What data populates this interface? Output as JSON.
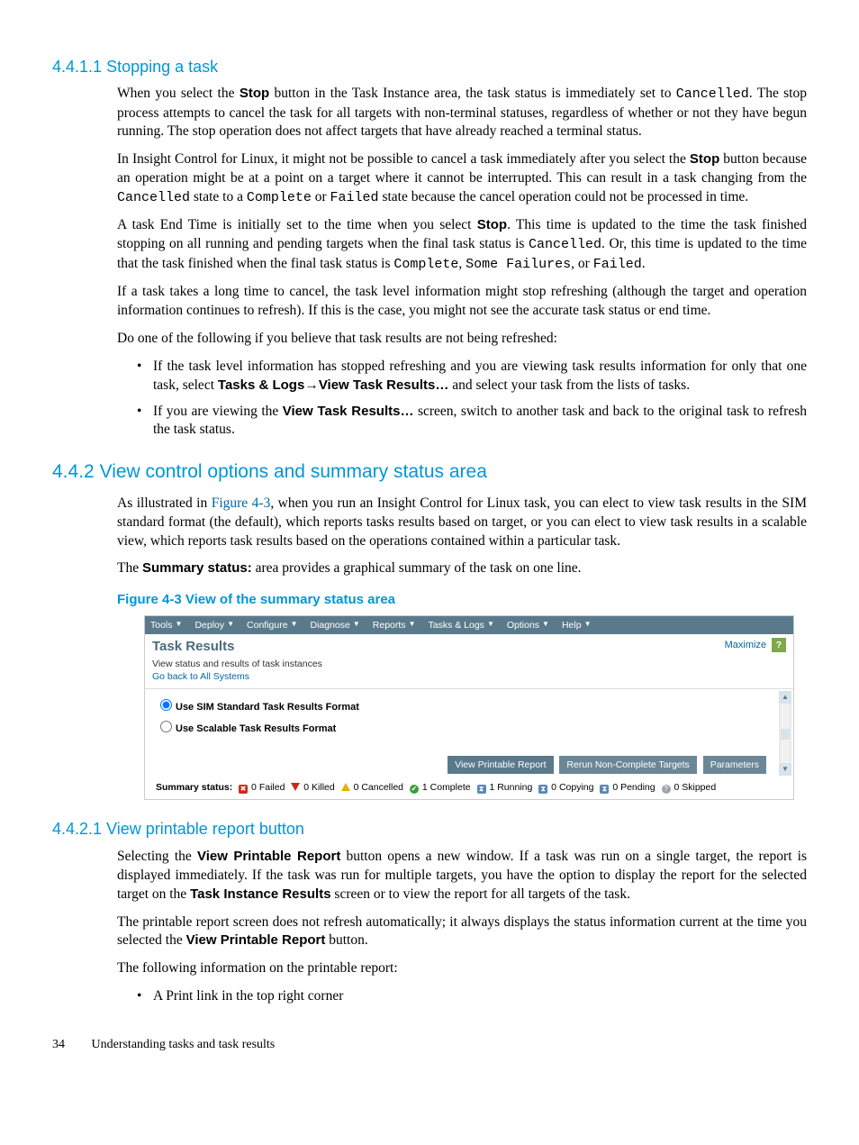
{
  "sections": {
    "s1_num": "4.4.1.1",
    "s1_title": "Stopping a task",
    "s2_num": "4.4.2",
    "s2_title": "View control options and summary status area",
    "s3_num": "4.4.2.1",
    "s3_title": "View printable report button"
  },
  "p": {
    "a1a": "When you select the ",
    "a1_stop": "Stop",
    "a1b": " button in the Task Instance area, the task status is immediately set to ",
    "a1_code": "Cancelled",
    "a1c": ". The stop process attempts to cancel the task for all targets with non-terminal statuses, regardless of whether or not they have begun running. The stop operation does not affect targets that have already reached a terminal status.",
    "a2a": "In Insight Control for Linux, it might not be possible to cancel a task immediately after you select the ",
    "a2b": " button because an operation might be at a point on a target where it cannot be interrupted. This can result in a task changing from the ",
    "a2_code1": "Cancelled",
    "a2c": " state to a ",
    "a2_code2": "Complete",
    "a2d": " or ",
    "a2_code3": "Failed",
    "a2e": " state because the cancel operation could not be processed in time.",
    "a3a": "A task End Time is initially set to the time when you select ",
    "a3b": ". This time is updated to the time the task finished stopping on all running and pending targets when the final task status is ",
    "a3_code1": "Cancelled",
    "a3c": ". Or, this time is updated to the time that the task finished when the final task status is ",
    "a3_code2": "Complete",
    "a3d": ", ",
    "a3_code3": "Some Failures",
    "a3e": ", or ",
    "a3_code4": "Failed",
    "a3f": ".",
    "a4": "If a task takes a long time to cancel, the task level information might stop refreshing (although the target and operation information continues to refresh). If this is the case, you might not see the accurate task status or end time.",
    "a5": "Do one of the following if you believe that task results are not being refreshed:",
    "b1a": "If the task level information has stopped refreshing and you are viewing task results information for only that one task, select ",
    "b1_bold1": "Tasks & Logs",
    "b1_arrow": "→",
    "b1_bold2": "View Task Results…",
    "b1b": " and select your task from the lists of tasks.",
    "b2a": "If you are viewing the ",
    "b2_bold": "View Task Results…",
    "b2b": " screen, switch to another task and back to the original task to refresh the task status.",
    "c1a": "As illustrated in ",
    "c1_xref": "Figure 4-3",
    "c1b": ", when you run an Insight Control for Linux task, you can elect to view task results in the SIM standard format (the default), which reports tasks results based on target, or you can elect to view task results in a scalable view, which reports task results based on the operations contained within a particular task.",
    "c2a": "The ",
    "c2_bold": "Summary status:",
    "c2b": " area provides a graphical summary of the task on one line.",
    "fig_caption": "Figure 4-3 View of the summary status area",
    "d1a": "Selecting the ",
    "d1_bold1": "View Printable Report",
    "d1b": " button opens a new window. If a task was run on a single target, the report is displayed immediately. If the task was run for multiple targets, you have the option to display the report for the selected target on the ",
    "d1_bold2": "Task Instance Results",
    "d1c": " screen or to view the report for all targets of the task.",
    "d2a": "The printable report screen does not refresh automatically; it always displays the status information current at the time you selected the ",
    "d2b": " button.",
    "d3": "The following information on the printable report:",
    "d_li1": "A Print link in the top right corner"
  },
  "figure": {
    "menu": [
      "Tools",
      "Deploy",
      "Configure",
      "Diagnose",
      "Reports",
      "Tasks & Logs",
      "Options",
      "Help"
    ],
    "title": "Task Results",
    "sub1": "View status and results of task instances",
    "sub2_link": "Go back to All Systems",
    "maximize": "Maximize",
    "help": "?",
    "radio1": "Use SIM Standard Task Results Format",
    "radio2": "Use Scalable Task Results Format",
    "buttons": [
      "View Printable Report",
      "Rerun Non-Complete Targets",
      "Parameters"
    ],
    "summary_label": "Summary status:",
    "statuses": [
      {
        "count": "0",
        "label": "Failed"
      },
      {
        "count": "0",
        "label": "Killed"
      },
      {
        "count": "0",
        "label": "Cancelled"
      },
      {
        "count": "1",
        "label": "Complete"
      },
      {
        "count": "1",
        "label": "Running"
      },
      {
        "count": "0",
        "label": "Copying"
      },
      {
        "count": "0",
        "label": "Pending"
      },
      {
        "count": "0",
        "label": "Skipped"
      }
    ]
  },
  "footer": {
    "page": "34",
    "chapter": "Understanding tasks and task results"
  }
}
